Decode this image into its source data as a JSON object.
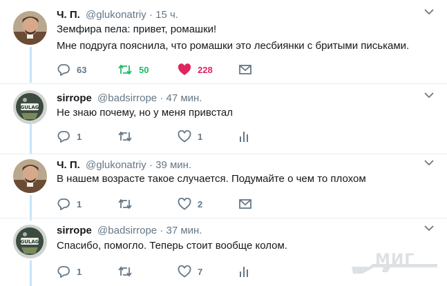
{
  "tweets": [
    {
      "name": "Ч. П.",
      "handle": "@glukonatriy",
      "sep": "·",
      "time": "15 ч.",
      "lines": [
        "Земфира пела: привет, ромашки!",
        "Мне подруга пояснила, что ромашки это лесбиянки с бритыми письками."
      ],
      "reply_count": "63",
      "retweet_count": "50",
      "like_count": "228"
    },
    {
      "name": "sirrope",
      "handle": "@badsirrope",
      "sep": "·",
      "time": "47 мин.",
      "lines": [
        "Не знаю почему, но у меня привстал"
      ],
      "reply_count": "1",
      "retweet_count": "",
      "like_count": "1"
    },
    {
      "name": "Ч. П.",
      "handle": "@glukonatriy",
      "sep": "·",
      "time": "39 мин.",
      "lines": [
        "В нашем возрасте такое случается. Подумайте о чем то плохом"
      ],
      "reply_count": "1",
      "retweet_count": "",
      "like_count": "2"
    },
    {
      "name": "sirrope",
      "handle": "@badsirrope",
      "sep": "·",
      "time": "37 мин.",
      "lines": [
        "Спасибо, помогло. Теперь стоит вообще колом."
      ],
      "reply_count": "1",
      "retweet_count": "",
      "like_count": "7"
    }
  ],
  "avatar_badge": "GULAG",
  "watermark": "МИГ",
  "colors": {
    "text": "#14171a",
    "muted": "#657786",
    "retweeted": "#17bf63",
    "liked": "#e0245e",
    "thread_line": "#c4e5fa",
    "separator": "#e6ecf0"
  }
}
